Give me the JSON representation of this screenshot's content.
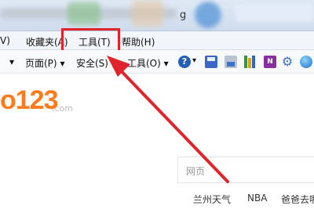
{
  "window": {
    "title_fragment": "g"
  },
  "menubar": {
    "items": [
      {
        "label": "V)"
      },
      {
        "label": "收藏夹(A)"
      },
      {
        "label": "工具(T)"
      },
      {
        "label": "帮助(H)"
      }
    ]
  },
  "commandbar": {
    "page_label": "页面(P)",
    "safety_label": "安全(S)",
    "tools_label": "工具(O)",
    "help_icon_glyph": "?",
    "onenote_glyph": "N",
    "dropdown_glyph": "▾",
    "icons": [
      "help-icon",
      "save-icon",
      "print-icon",
      "bookshelf-icon",
      "onenote-icon",
      "gear-icon",
      "globe-icon"
    ]
  },
  "page": {
    "logo_text": "o123",
    "logo_suffix": ".com",
    "search_placeholder": "网页",
    "links": [
      "兰州天气",
      "NBA",
      "爸爸去哪"
    ]
  },
  "colors": {
    "highlight": "#e0242b",
    "logo": "#ff7a1a"
  }
}
